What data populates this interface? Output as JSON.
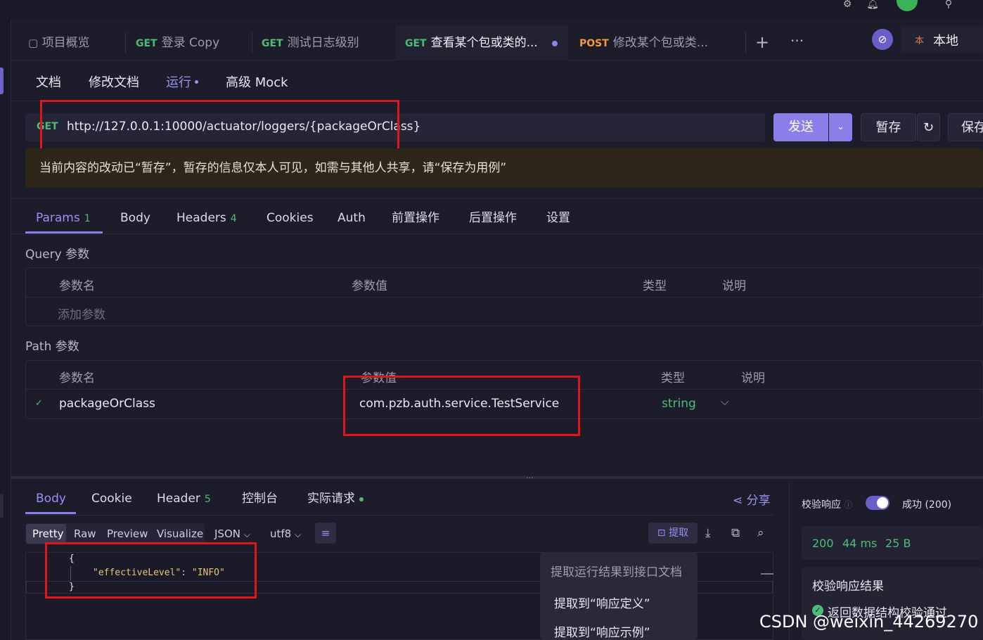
{
  "tabs": [
    {
      "method": "",
      "label": "项目概览"
    },
    {
      "method": "GET",
      "label": "登录 Copy"
    },
    {
      "method": "GET",
      "label": "测试日志级别"
    },
    {
      "method": "GET",
      "label": "查看某个包或类的..."
    },
    {
      "method": "POST",
      "label": "修改某个包或类..."
    }
  ],
  "env": {
    "badge": "本",
    "label": "本地"
  },
  "subtabs": [
    "文档",
    "修改文档",
    "运行",
    "高级 Mock"
  ],
  "request": {
    "method": "GET",
    "url": "http://127.0.0.1:10000/actuator/loggers/{packageOrClass}",
    "send_label": "发送",
    "stash_label": "暂存",
    "save_label": "保存"
  },
  "notice": "当前内容的改动已“暂存”，暂存的信息仅本人可见，如需与其他人共享，请“保存为用例”",
  "param_tabs": [
    {
      "label": "Params",
      "count": "1"
    },
    {
      "label": "Body",
      "count": ""
    },
    {
      "label": "Headers",
      "count": "4"
    },
    {
      "label": "Cookies",
      "count": ""
    },
    {
      "label": "Auth",
      "count": ""
    },
    {
      "label": "前置操作",
      "count": ""
    },
    {
      "label": "后置操作",
      "count": ""
    },
    {
      "label": "设置",
      "count": ""
    }
  ],
  "query": {
    "title": "Query 参数",
    "headers": [
      "参数名",
      "参数值",
      "类型",
      "说明"
    ],
    "add_placeholder": "添加参数"
  },
  "path": {
    "title": "Path 参数",
    "headers": [
      "参数名",
      "参数值",
      "类型",
      "说明"
    ],
    "row": {
      "name": "packageOrClass",
      "value": "com.pzb.auth.service.TestService",
      "type": "string"
    }
  },
  "response_tabs": [
    {
      "label": "Body",
      "count": ""
    },
    {
      "label": "Cookie",
      "count": ""
    },
    {
      "label": "Header",
      "count": "5"
    },
    {
      "label": "控制台",
      "count": ""
    },
    {
      "label": "实际请求",
      "count": ""
    }
  ],
  "share_label": "分享",
  "format": {
    "views": [
      "Pretty",
      "Raw",
      "Preview",
      "Visualize"
    ],
    "lang": "JSON",
    "encoding": "utf8",
    "extract_label": "提取"
  },
  "code_lines": [
    "{",
    "\"effectiveLevel\": \"INFO\"",
    "}"
  ],
  "popup": {
    "title": "提取运行结果到接口文档",
    "items": [
      "提取到“响应定义”",
      "提取到“响应示例”"
    ]
  },
  "validate": {
    "label": "校验响应",
    "status": "成功 (200)",
    "code": "200",
    "time": "44 ms",
    "size": "25 B",
    "result_title": "校验响应结果",
    "result_text": "返回数据结构校验通过"
  },
  "watermark": "CSDN @weixin_44269270",
  "colors": {
    "accent": "#8c7ee8",
    "get": "#4dbd74",
    "post": "#f39a3c",
    "highlight": "#e0161b"
  }
}
